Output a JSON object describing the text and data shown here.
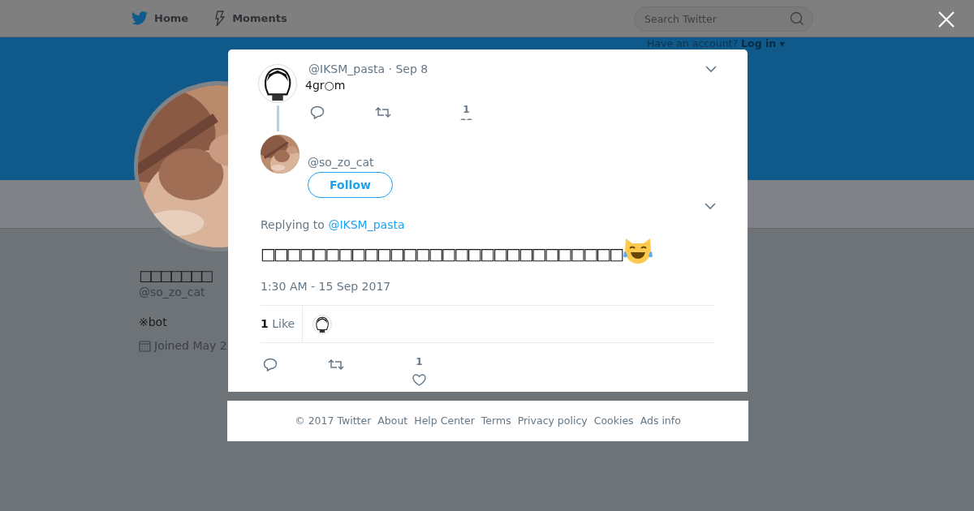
{
  "nav": {
    "items": [
      {
        "label": "Home"
      },
      {
        "label": "Moments"
      }
    ],
    "search": {
      "placeholder": "Search Twitter"
    },
    "login": {
      "prompt": "Have an account?",
      "link": "Log in",
      "caret": "▾"
    }
  },
  "profile": {
    "name": "□□□□□□□",
    "handle": "@so_zo_cat",
    "bio": "※bot",
    "joined": "Joined May 2"
  },
  "parent_tweet": {
    "handle": "@IKSM_pasta",
    "separator": "·",
    "date": "Sep 8",
    "text": "4gr○m",
    "like_count": "1"
  },
  "tweet": {
    "handle": "@so_zo_cat",
    "follow": "Follow",
    "replying_label": "Replying to",
    "replying_to": "@IKSM_pasta",
    "text": "□□□□□□□□□□□□□□□□□□□□□□□□□□□□",
    "timestamp": "1:30 AM - 15 Sep 2017",
    "likes_count": "1",
    "likes_label": "Like",
    "action_like_count": "1"
  },
  "footer": {
    "links": [
      "© 2017 Twitter",
      "About",
      "Help Center",
      "Terms",
      "Privacy policy",
      "Cookies",
      "Ads info"
    ]
  }
}
